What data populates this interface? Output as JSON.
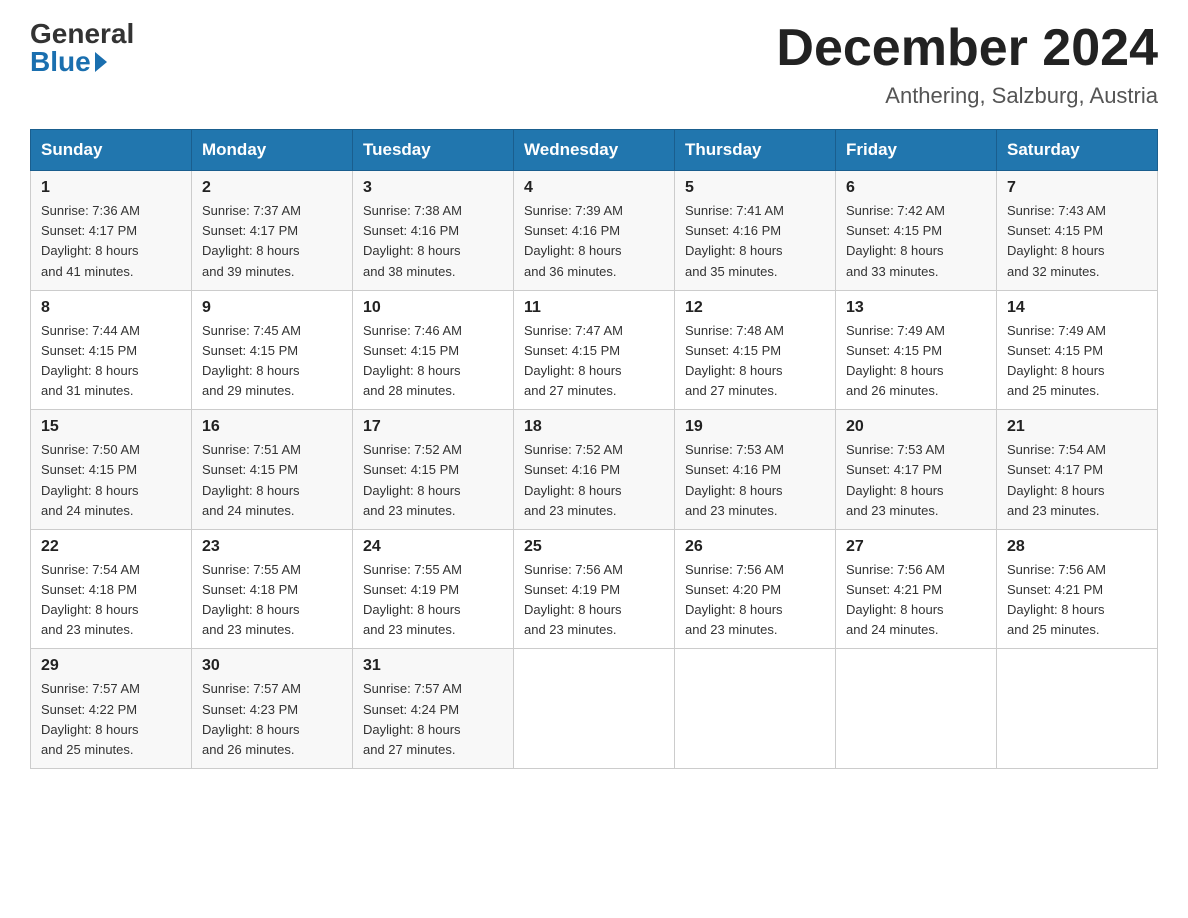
{
  "logo": {
    "general": "General",
    "blue": "Blue"
  },
  "title": "December 2024",
  "subtitle": "Anthering, Salzburg, Austria",
  "days_of_week": [
    "Sunday",
    "Monday",
    "Tuesday",
    "Wednesday",
    "Thursday",
    "Friday",
    "Saturday"
  ],
  "weeks": [
    [
      {
        "day": "1",
        "sunrise": "7:36 AM",
        "sunset": "4:17 PM",
        "daylight": "8 hours and 41 minutes."
      },
      {
        "day": "2",
        "sunrise": "7:37 AM",
        "sunset": "4:17 PM",
        "daylight": "8 hours and 39 minutes."
      },
      {
        "day": "3",
        "sunrise": "7:38 AM",
        "sunset": "4:16 PM",
        "daylight": "8 hours and 38 minutes."
      },
      {
        "day": "4",
        "sunrise": "7:39 AM",
        "sunset": "4:16 PM",
        "daylight": "8 hours and 36 minutes."
      },
      {
        "day": "5",
        "sunrise": "7:41 AM",
        "sunset": "4:16 PM",
        "daylight": "8 hours and 35 minutes."
      },
      {
        "day": "6",
        "sunrise": "7:42 AM",
        "sunset": "4:15 PM",
        "daylight": "8 hours and 33 minutes."
      },
      {
        "day": "7",
        "sunrise": "7:43 AM",
        "sunset": "4:15 PM",
        "daylight": "8 hours and 32 minutes."
      }
    ],
    [
      {
        "day": "8",
        "sunrise": "7:44 AM",
        "sunset": "4:15 PM",
        "daylight": "8 hours and 31 minutes."
      },
      {
        "day": "9",
        "sunrise": "7:45 AM",
        "sunset": "4:15 PM",
        "daylight": "8 hours and 29 minutes."
      },
      {
        "day": "10",
        "sunrise": "7:46 AM",
        "sunset": "4:15 PM",
        "daylight": "8 hours and 28 minutes."
      },
      {
        "day": "11",
        "sunrise": "7:47 AM",
        "sunset": "4:15 PM",
        "daylight": "8 hours and 27 minutes."
      },
      {
        "day": "12",
        "sunrise": "7:48 AM",
        "sunset": "4:15 PM",
        "daylight": "8 hours and 27 minutes."
      },
      {
        "day": "13",
        "sunrise": "7:49 AM",
        "sunset": "4:15 PM",
        "daylight": "8 hours and 26 minutes."
      },
      {
        "day": "14",
        "sunrise": "7:49 AM",
        "sunset": "4:15 PM",
        "daylight": "8 hours and 25 minutes."
      }
    ],
    [
      {
        "day": "15",
        "sunrise": "7:50 AM",
        "sunset": "4:15 PM",
        "daylight": "8 hours and 24 minutes."
      },
      {
        "day": "16",
        "sunrise": "7:51 AM",
        "sunset": "4:15 PM",
        "daylight": "8 hours and 24 minutes."
      },
      {
        "day": "17",
        "sunrise": "7:52 AM",
        "sunset": "4:15 PM",
        "daylight": "8 hours and 23 minutes."
      },
      {
        "day": "18",
        "sunrise": "7:52 AM",
        "sunset": "4:16 PM",
        "daylight": "8 hours and 23 minutes."
      },
      {
        "day": "19",
        "sunrise": "7:53 AM",
        "sunset": "4:16 PM",
        "daylight": "8 hours and 23 minutes."
      },
      {
        "day": "20",
        "sunrise": "7:53 AM",
        "sunset": "4:17 PM",
        "daylight": "8 hours and 23 minutes."
      },
      {
        "day": "21",
        "sunrise": "7:54 AM",
        "sunset": "4:17 PM",
        "daylight": "8 hours and 23 minutes."
      }
    ],
    [
      {
        "day": "22",
        "sunrise": "7:54 AM",
        "sunset": "4:18 PM",
        "daylight": "8 hours and 23 minutes."
      },
      {
        "day": "23",
        "sunrise": "7:55 AM",
        "sunset": "4:18 PM",
        "daylight": "8 hours and 23 minutes."
      },
      {
        "day": "24",
        "sunrise": "7:55 AM",
        "sunset": "4:19 PM",
        "daylight": "8 hours and 23 minutes."
      },
      {
        "day": "25",
        "sunrise": "7:56 AM",
        "sunset": "4:19 PM",
        "daylight": "8 hours and 23 minutes."
      },
      {
        "day": "26",
        "sunrise": "7:56 AM",
        "sunset": "4:20 PM",
        "daylight": "8 hours and 23 minutes."
      },
      {
        "day": "27",
        "sunrise": "7:56 AM",
        "sunset": "4:21 PM",
        "daylight": "8 hours and 24 minutes."
      },
      {
        "day": "28",
        "sunrise": "7:56 AM",
        "sunset": "4:21 PM",
        "daylight": "8 hours and 25 minutes."
      }
    ],
    [
      {
        "day": "29",
        "sunrise": "7:57 AM",
        "sunset": "4:22 PM",
        "daylight": "8 hours and 25 minutes."
      },
      {
        "day": "30",
        "sunrise": "7:57 AM",
        "sunset": "4:23 PM",
        "daylight": "8 hours and 26 minutes."
      },
      {
        "day": "31",
        "sunrise": "7:57 AM",
        "sunset": "4:24 PM",
        "daylight": "8 hours and 27 minutes."
      },
      null,
      null,
      null,
      null
    ]
  ],
  "labels": {
    "sunrise": "Sunrise:",
    "sunset": "Sunset:",
    "daylight": "Daylight:"
  }
}
